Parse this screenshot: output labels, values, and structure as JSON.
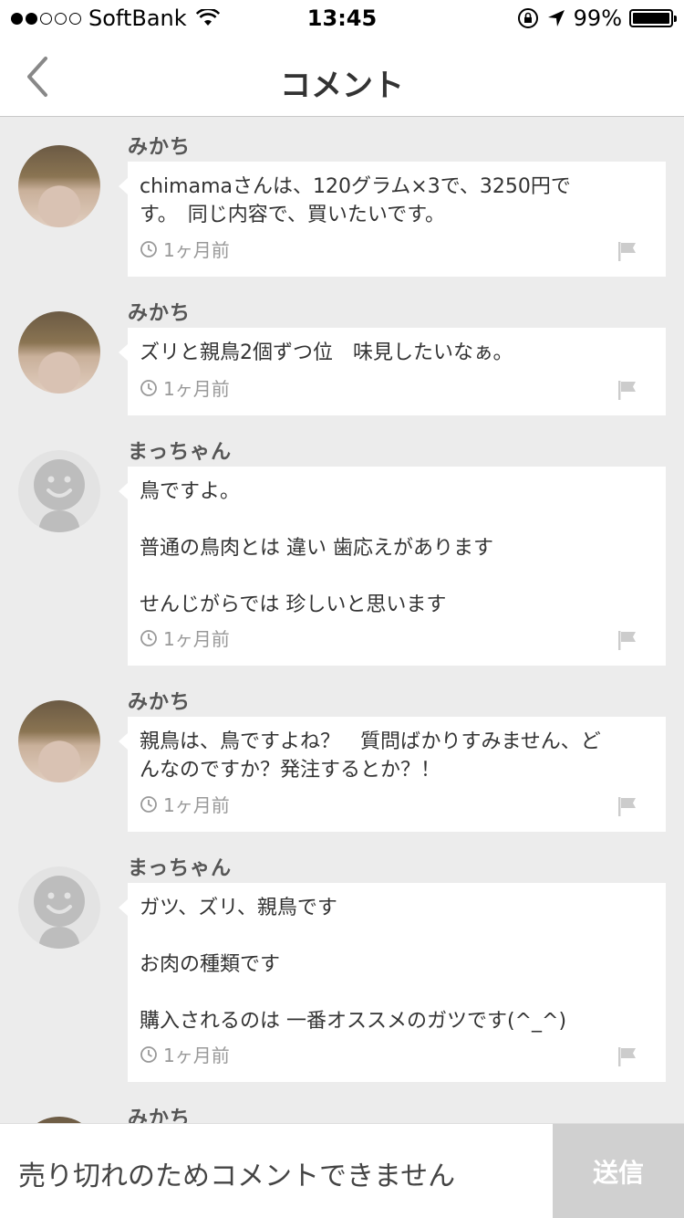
{
  "status_bar": {
    "carrier": "SoftBank",
    "time": "13:45",
    "battery": "99%",
    "battery_level": 0.99,
    "signal_bars_filled": 2,
    "signal_bars_total": 5
  },
  "header": {
    "title": "コメント",
    "back_icon": "chevron-left-icon"
  },
  "comments": [
    {
      "author": "みかち",
      "avatar": "photo",
      "body": "chimamaさんは、120グラム×3で、3250円で\nす。　同じ内容で、買いたいです。",
      "time": "1ヶ月前"
    },
    {
      "author": "みかち",
      "avatar": "photo",
      "body": "ズリと親鳥2個ずつ位　味見したいなぁ。",
      "time": "1ヶ月前"
    },
    {
      "author": "まっちゃん",
      "avatar": "default",
      "body": "鳥ですよ。\n\n普通の鳥肉とは 違い 歯応えがあります\n\nせんじがらでは 珍しいと思います",
      "time": "1ヶ月前"
    },
    {
      "author": "みかち",
      "avatar": "photo",
      "body": "親鳥は、鳥ですよね？　質問ばかりすみません、ど\nんなのですか？発注するとか？！",
      "time": "1ヶ月前"
    },
    {
      "author": "まっちゃん",
      "avatar": "default",
      "body": "ガツ、ズリ、親鳥です\n\nお肉の種類です\n\n購入されるのは 一番オススメのガツです(^_^)",
      "time": "1ヶ月前"
    },
    {
      "author": "みかち",
      "avatar": "photo",
      "body": "",
      "time": ""
    }
  ],
  "footer": {
    "input_text": "売り切れのためコメントできません",
    "send_label": "送信"
  },
  "colors": {
    "background": "#ececec",
    "bubble": "#ffffff",
    "send_disabled": "#d0d0d0",
    "meta_text": "#999999"
  }
}
